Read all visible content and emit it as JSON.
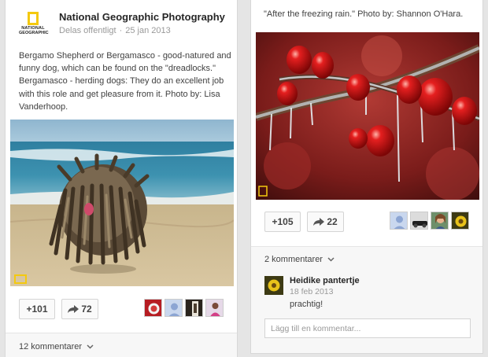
{
  "left_post": {
    "author": "National Geographic Photography",
    "visibility": "Delas offentligt",
    "date": "25 jan 2013",
    "logo_line1": "NATIONAL",
    "logo_line2": "GEOGRAPHIC",
    "description": "Bergamo Shepherd or Bergamasco - good-natured and funny dog, which can be found on the \"dreadlocks.\" Bergamasco - herding dogs: They do an excellent job with this role and get pleasure from it. Photo by: Lisa Vanderhoop.",
    "plus_count": "+101",
    "share_count": "72",
    "comments_label": "12 kommentarer",
    "commenter_avatars": [
      "avatar-red-icon",
      "avatar-default-icon",
      "avatar-dark-icon",
      "avatar-pink-icon"
    ]
  },
  "right_post": {
    "description": "\"After the freezing rain.\" Photo by: Shannon O'Hara.",
    "plus_count": "+105",
    "share_count": "22",
    "comments_label": "2 kommentarer",
    "commenter_avatars": [
      "avatar-default-icon",
      "avatar-car-icon",
      "avatar-woman-icon",
      "avatar-flower-icon"
    ],
    "comment": {
      "author": "Heidike pantertje",
      "date": "18 feb 2013",
      "text": "prachtig!"
    },
    "comment_placeholder": "Lägg till en kommentar..."
  }
}
